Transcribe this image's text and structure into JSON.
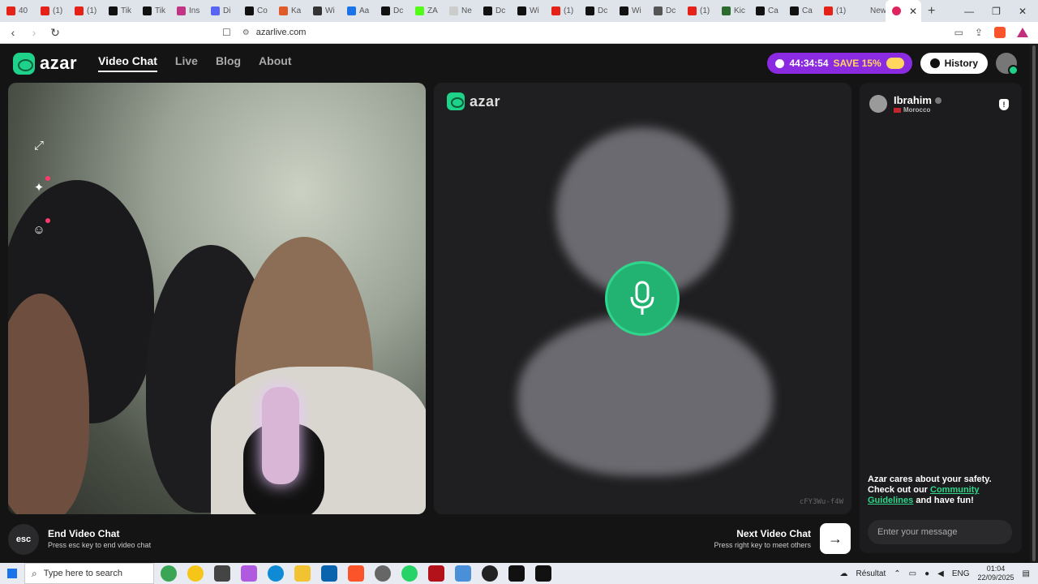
{
  "browser": {
    "tabs": [
      {
        "label": "40",
        "color": "#e62117"
      },
      {
        "label": "(1)",
        "color": "#e62117"
      },
      {
        "label": "(1)",
        "color": "#e62117"
      },
      {
        "label": "Tik",
        "color": "#111111"
      },
      {
        "label": "Tik",
        "color": "#111111"
      },
      {
        "label": "Ins",
        "color": "#c13584"
      },
      {
        "label": "Di",
        "color": "#5865f2"
      },
      {
        "label": "Co",
        "color": "#111111"
      },
      {
        "label": "Ka",
        "color": "#e05a2a"
      },
      {
        "label": "Wi",
        "color": "#333333"
      },
      {
        "label": "Aa",
        "color": "#1a73e8"
      },
      {
        "label": "Dc",
        "color": "#111111"
      },
      {
        "label": "ZA",
        "color": "#53fc18"
      },
      {
        "label": "Ne",
        "color": "#cccccc"
      },
      {
        "label": "Dc",
        "color": "#111111"
      },
      {
        "label": "Wi",
        "color": "#111111"
      },
      {
        "label": "(1)",
        "color": "#e62117"
      },
      {
        "label": "Dc",
        "color": "#111111"
      },
      {
        "label": "Wi",
        "color": "#111111"
      },
      {
        "label": "Dc",
        "color": "#555555"
      },
      {
        "label": "(1)",
        "color": "#e62117"
      },
      {
        "label": "Kic",
        "color": "#2d6a2d"
      },
      {
        "label": "Ca",
        "color": "#111111"
      },
      {
        "label": "Ca",
        "color": "#111111"
      },
      {
        "label": "(1)",
        "color": "#e62117"
      },
      {
        "label": "New t",
        "color": "#dfe3ea"
      }
    ],
    "url": "azarlive.com"
  },
  "header": {
    "logo_text": "azar",
    "nav": [
      "Video Chat",
      "Live",
      "Blog",
      "About"
    ],
    "promo_timer": "44:34:54",
    "promo_save": "SAVE 15%",
    "history_label": "History"
  },
  "remote": {
    "logo_text": "azar",
    "stream_id": "cFY3Wu-f4W"
  },
  "chat": {
    "user_name": "Ibrahim",
    "user_country": "Morocco",
    "report_symbol": "!",
    "safety_line1": "Azar cares about your safety.",
    "safety_line2": "Check out our",
    "safety_link": "Community Guidelines",
    "safety_line3": "and have fun!",
    "input_placeholder": "Enter your message"
  },
  "controls": {
    "esc_label": "esc",
    "end_title": "End Video Chat",
    "end_sub": "Press esc key to end video chat",
    "next_title": "Next Video Chat",
    "next_sub": "Press right key to meet others",
    "next_symbol": "→"
  },
  "taskbar": {
    "search_placeholder": "Type here to search",
    "weather": "Résultat",
    "lang": "ENG",
    "time": "01:04",
    "date": "22/09/2025"
  },
  "colors": {
    "brand_green": "#1fd28a",
    "promo_purple": "#8a2be2"
  }
}
